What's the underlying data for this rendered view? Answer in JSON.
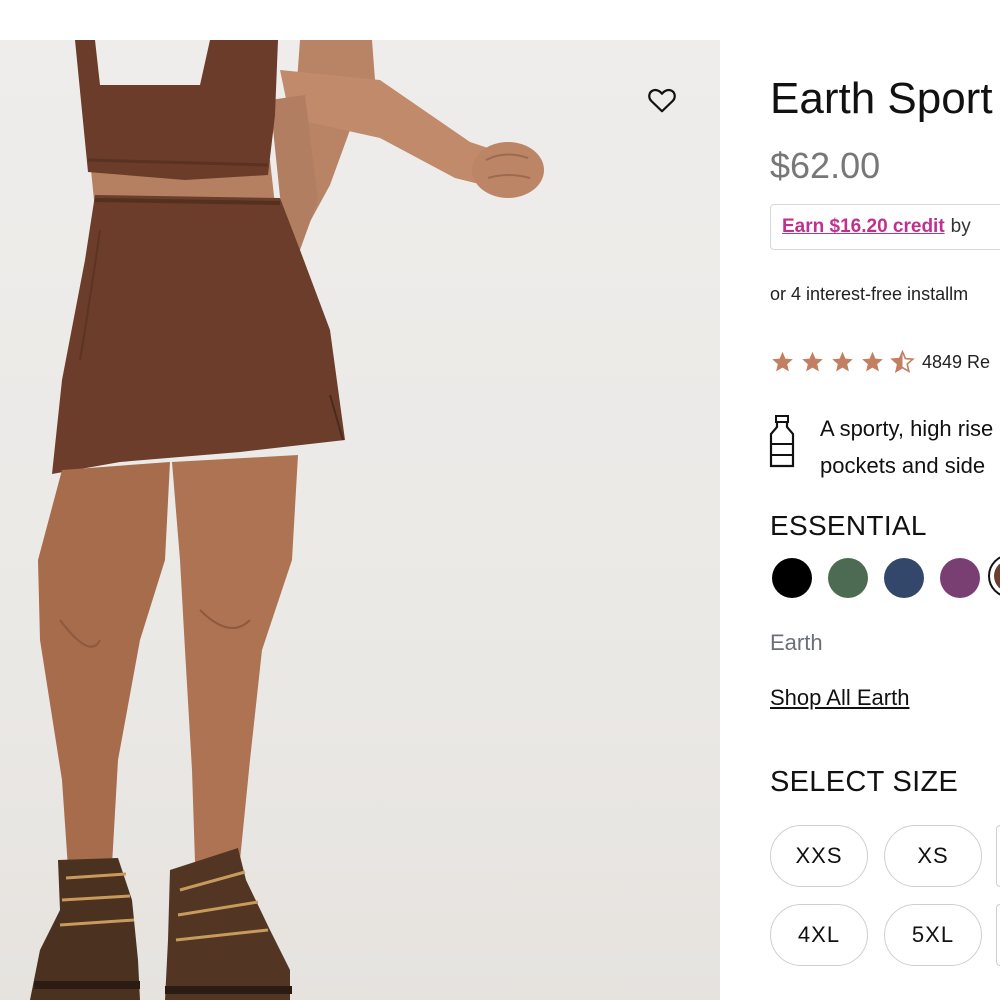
{
  "product": {
    "title": "Earth Sport",
    "price": "$62.00",
    "wishlist_icon": "heart-outline-icon",
    "credit": {
      "link_text": "Earn $16.20 credit",
      "suffix": "by"
    },
    "installments": "or 4 interest-free installm",
    "rating": {
      "value": 4.5,
      "max": 5,
      "star_color": "#c27f61",
      "reviews_text": "4849 Re"
    },
    "description": {
      "icon": "water-bottle-icon",
      "line1": "A sporty, high rise",
      "line2": "pockets and side"
    },
    "collection": "ESSENTIAL",
    "swatches": [
      {
        "name": "black",
        "color": "#000000"
      },
      {
        "name": "green",
        "color": "#4d6b53"
      },
      {
        "name": "navy",
        "color": "#33476b"
      },
      {
        "name": "plum",
        "color": "#7a3f72"
      },
      {
        "name": "earth",
        "color": "#6a3f2b",
        "selected": true
      }
    ],
    "selected_color": "Earth",
    "shop_all": "Shop All Earth",
    "select_size_label": "SELECT SIZE",
    "sizes_row1": [
      "XXS",
      "XS"
    ],
    "sizes_row2": [
      "4XL",
      "5XL"
    ]
  }
}
